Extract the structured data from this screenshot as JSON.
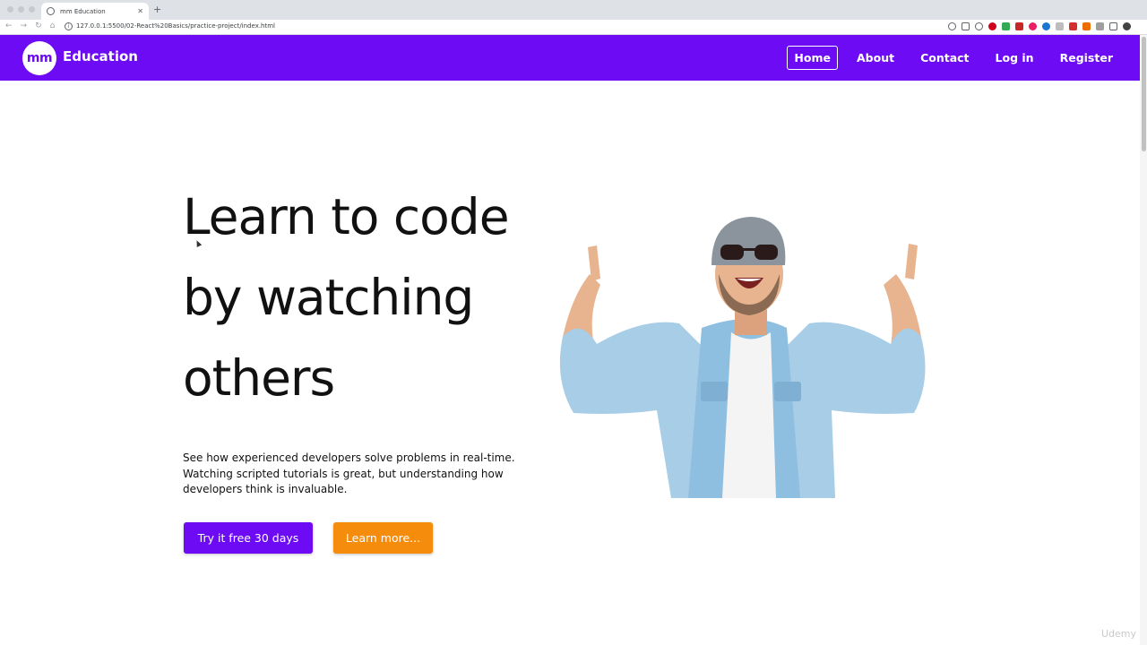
{
  "browser": {
    "tab_title": "mm Education",
    "new_tab": "+",
    "url": "127.0.0.1:5500/02-React%20Basics/practice-project/index.html",
    "nav_icons": [
      "back-icon",
      "forward-icon",
      "reload-icon",
      "home-icon"
    ]
  },
  "header": {
    "logo_text": "mm",
    "brand": "Education",
    "nav": [
      {
        "label": "Home",
        "active": true
      },
      {
        "label": "About"
      },
      {
        "label": "Contact"
      },
      {
        "label": "Log in"
      },
      {
        "label": "Register"
      }
    ]
  },
  "hero": {
    "title_lines": [
      "Learn to code",
      "by watching",
      "others"
    ],
    "description_lines": [
      "See how experienced developers solve problems in real-time.",
      "Watching scripted tutorials is great, but understanding how",
      "developers think is invaluable."
    ],
    "primary_button": "Try it free 30 days",
    "secondary_button": "Learn more..."
  },
  "watermark": "Udemy",
  "colors": {
    "brand": "#6c0bf4",
    "accent": "#f68c0b"
  }
}
